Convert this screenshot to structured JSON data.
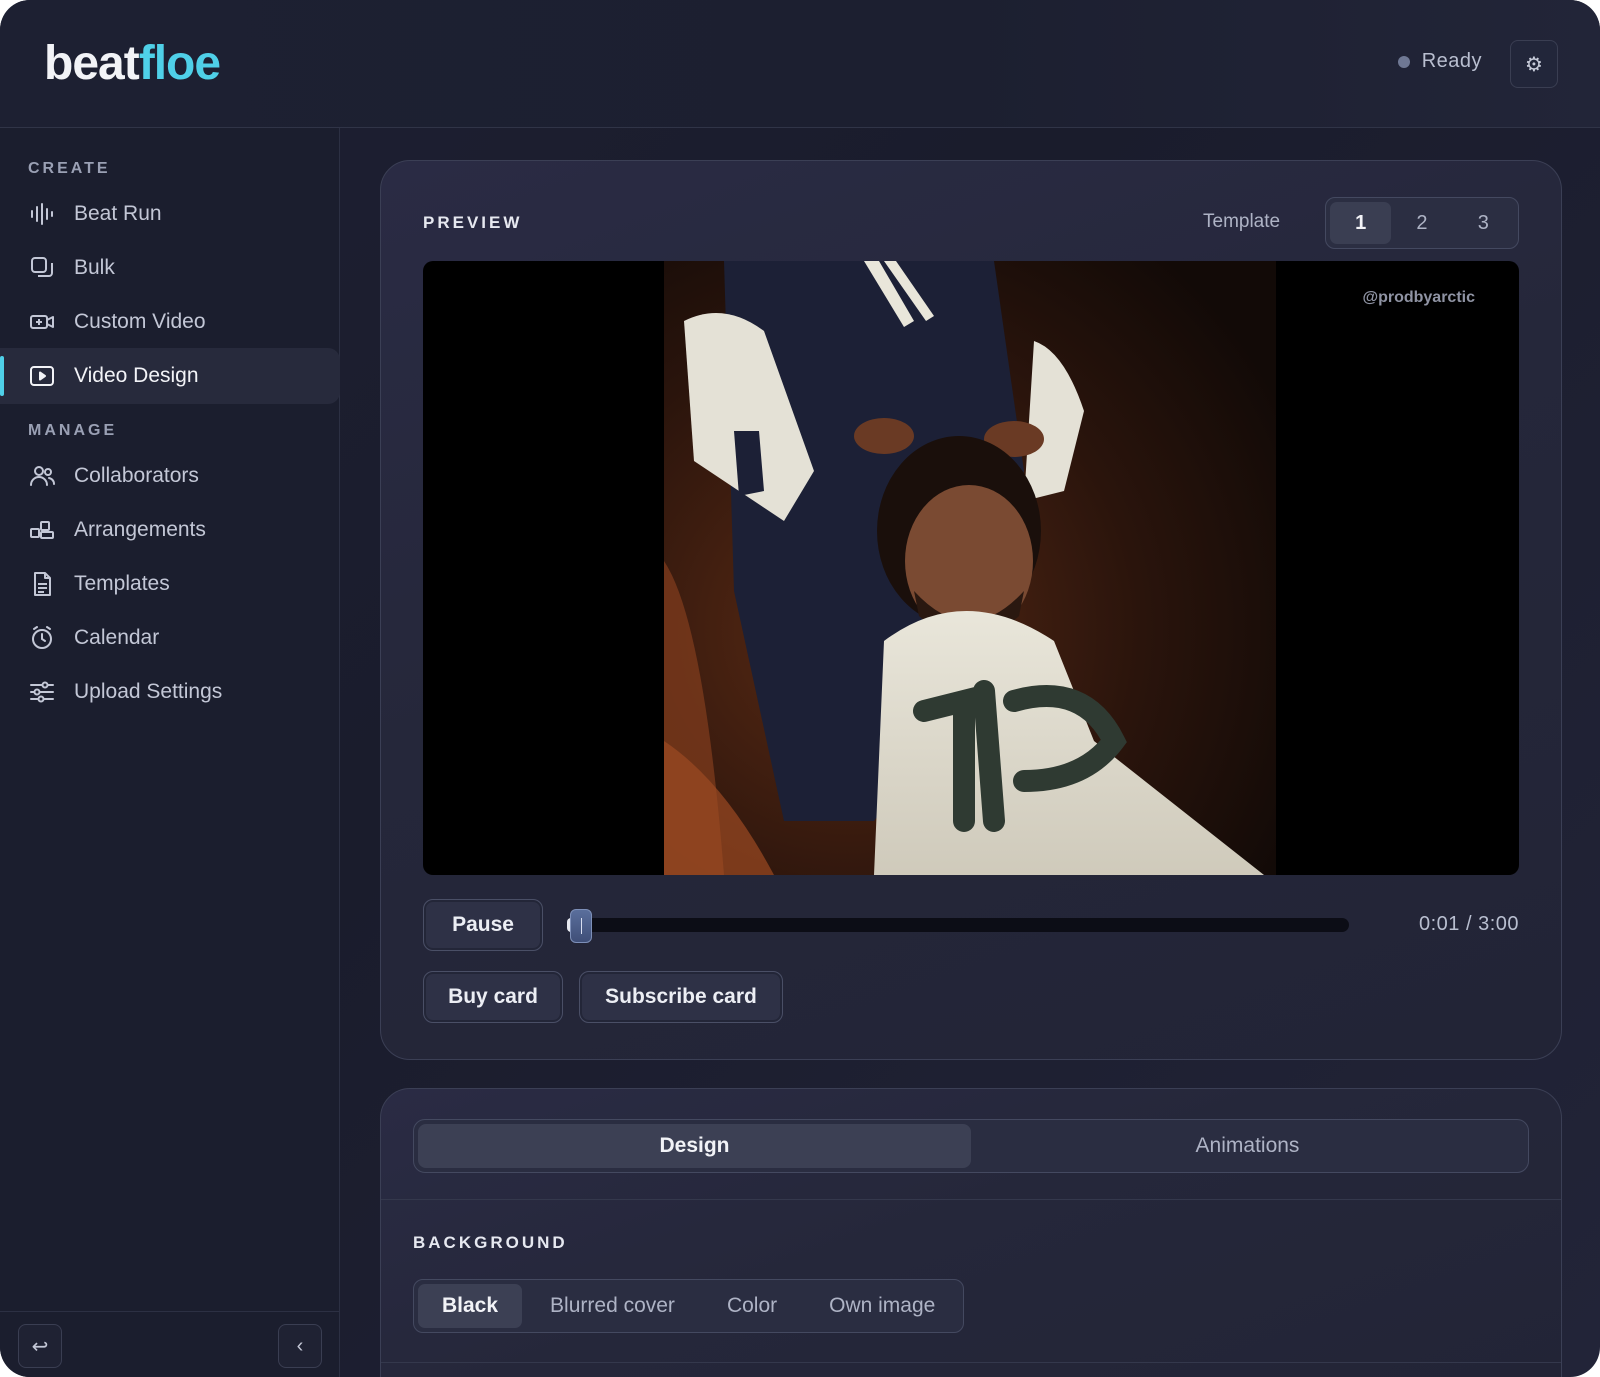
{
  "app": {
    "logo_part1": "beat",
    "logo_part2": "floe",
    "status": "Ready",
    "accent_color": "#4fd0e8"
  },
  "sidebar": {
    "create_label": "CREATE",
    "manage_label": "MANAGE",
    "create_items": [
      {
        "label": "Beat Run",
        "icon": "waveform-icon"
      },
      {
        "label": "Bulk",
        "icon": "stack-icon"
      },
      {
        "label": "Custom Video",
        "icon": "video-camera-icon"
      },
      {
        "label": "Video Design",
        "icon": "play-screen-icon",
        "active": true
      }
    ],
    "manage_items": [
      {
        "label": "Collaborators",
        "icon": "users-icon"
      },
      {
        "label": "Arrangements",
        "icon": "blocks-icon"
      },
      {
        "label": "Templates",
        "icon": "document-icon"
      },
      {
        "label": "Calendar",
        "icon": "timer-icon"
      },
      {
        "label": "Upload Settings",
        "icon": "sliders-icon"
      }
    ],
    "footer": {
      "left_icon": "return-icon",
      "right_icon": "chevron-left-icon"
    }
  },
  "preview": {
    "title": "PREVIEW",
    "template_label": "Template",
    "templates": [
      "1",
      "2",
      "3"
    ],
    "selected_template": "1",
    "watermark": "@prodbyarctic",
    "pause_label": "Pause",
    "buy_card_label": "Buy card",
    "subscribe_card_label": "Subscribe card",
    "time": "0:01 / 3:00",
    "progress_fraction": 0.0055
  },
  "design": {
    "tabs": [
      "Design",
      "Animations"
    ],
    "active_tab": "Design",
    "background_label": "BACKGROUND",
    "background_options": [
      "Black",
      "Blurred cover",
      "Color",
      "Own image"
    ],
    "selected_background": "Black"
  }
}
